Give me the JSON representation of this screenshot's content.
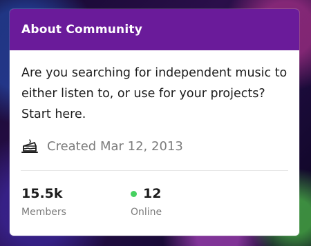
{
  "card": {
    "title": "About Community",
    "description": "Are you searching for independent music to either listen to, or use for your projects? Start here.",
    "created": "Created Mar 12, 2013",
    "header_color": "#6a1b9a",
    "created_icon": "cake-icon"
  },
  "stats": {
    "members": {
      "value": "15.5k",
      "label": "Members"
    },
    "online": {
      "value": "12",
      "label": "Online",
      "dot_color": "#46d160"
    }
  }
}
